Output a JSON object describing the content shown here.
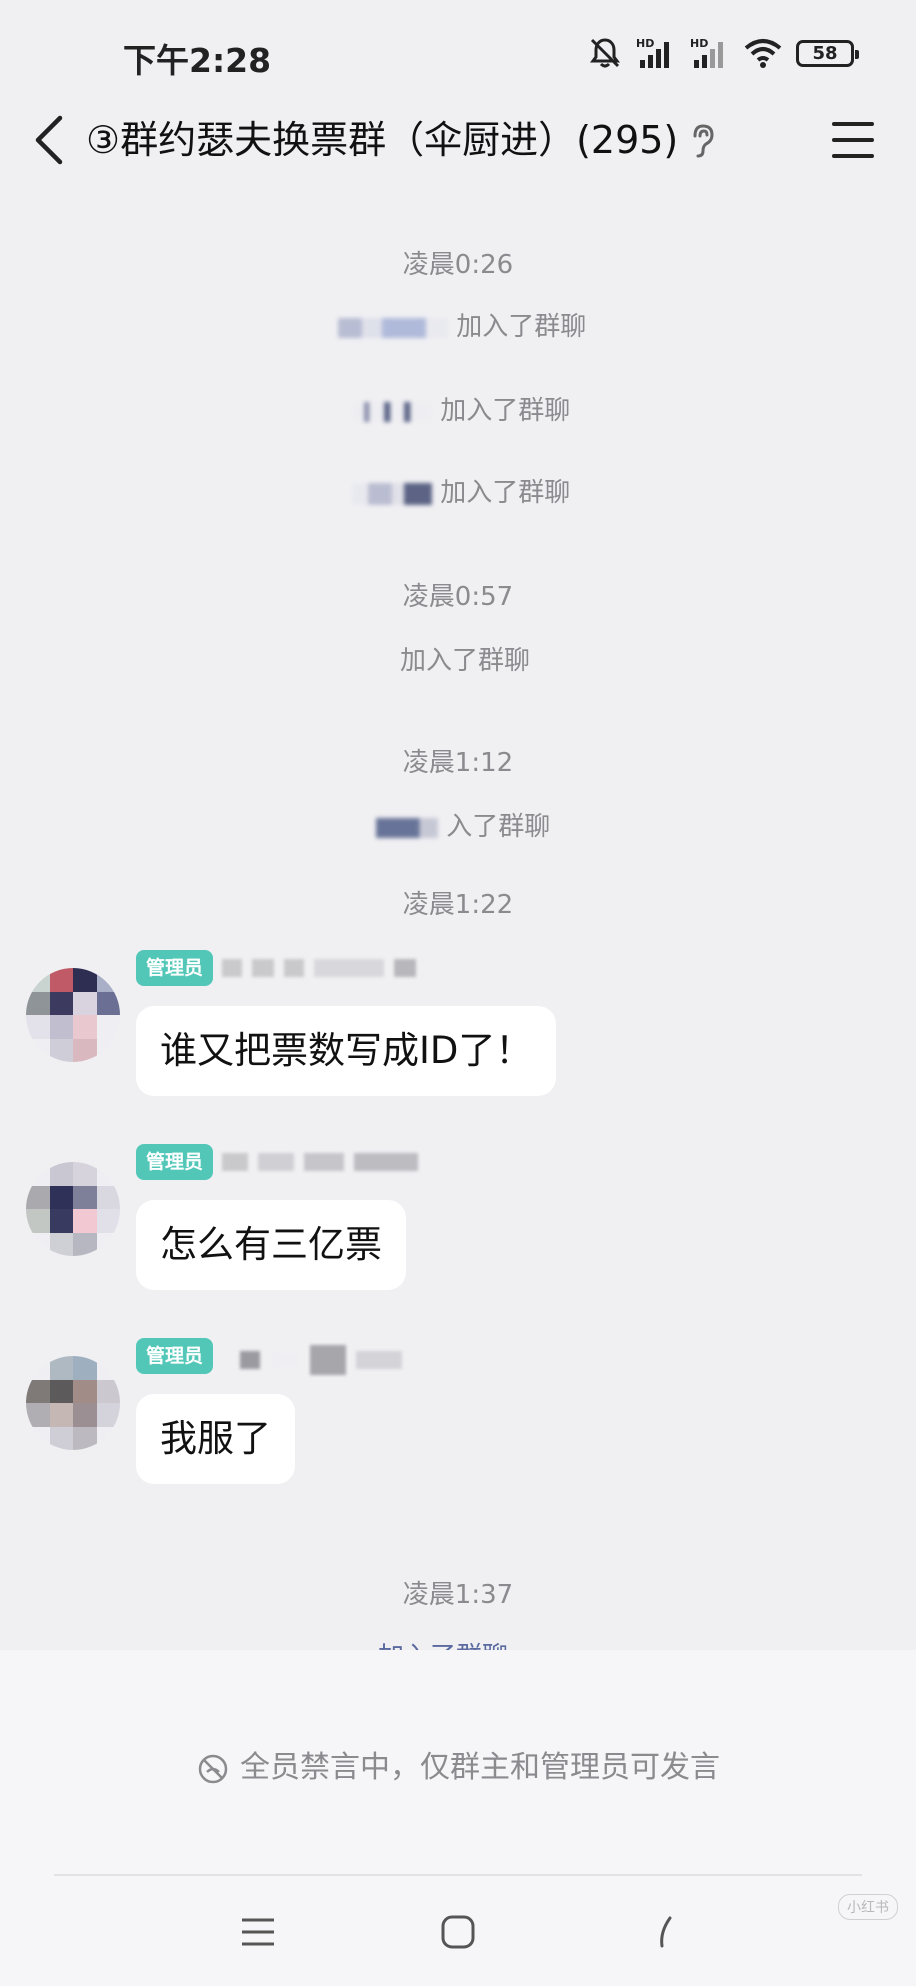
{
  "status_bar": {
    "time": "下午2:28",
    "battery": "58",
    "icons": [
      "mute-bell-icon",
      "hd-signal-icon",
      "hd-signal-icon",
      "wifi-icon",
      "battery-icon"
    ]
  },
  "title_bar": {
    "title": "③群约瑟夫换票群（伞厨进）(295)",
    "icons": [
      "back-arrow-icon",
      "ear-icon",
      "menu-icon"
    ]
  },
  "chat": {
    "events": [
      {
        "time": "凌晨0:26"
      },
      {
        "join": "加入了群聊"
      },
      {
        "join": "加入了群聊"
      },
      {
        "join": "加入了群聊"
      },
      {
        "time": "凌晨0:57"
      },
      {
        "join": "加入了群聊"
      },
      {
        "time": "凌晨1:12"
      },
      {
        "join": "入了群聊"
      },
      {
        "time": "凌晨1:22"
      },
      {
        "time": "凌晨1:37"
      }
    ],
    "messages": [
      {
        "badge": "管理员",
        "text": "谁又把票数写成ID了！"
      },
      {
        "badge": "管理员",
        "text": "怎么有三亿票"
      },
      {
        "badge": "管理员",
        "text": "我服了"
      }
    ],
    "partial_join": "加入了群聊"
  },
  "mute_bar": {
    "text": "全员禁言中，仅群主和管理员可发言",
    "icon": "mute-circle-icon"
  },
  "nav_bar": {
    "buttons": [
      "menu-nav-icon",
      "home-nav-icon",
      "back-nav-icon"
    ],
    "watermark": "小红书"
  },
  "colors": {
    "background": "#f0f0f3",
    "badge": "#52c7b8",
    "bubble": "#ffffff",
    "system_text": "#8a8a8f"
  }
}
